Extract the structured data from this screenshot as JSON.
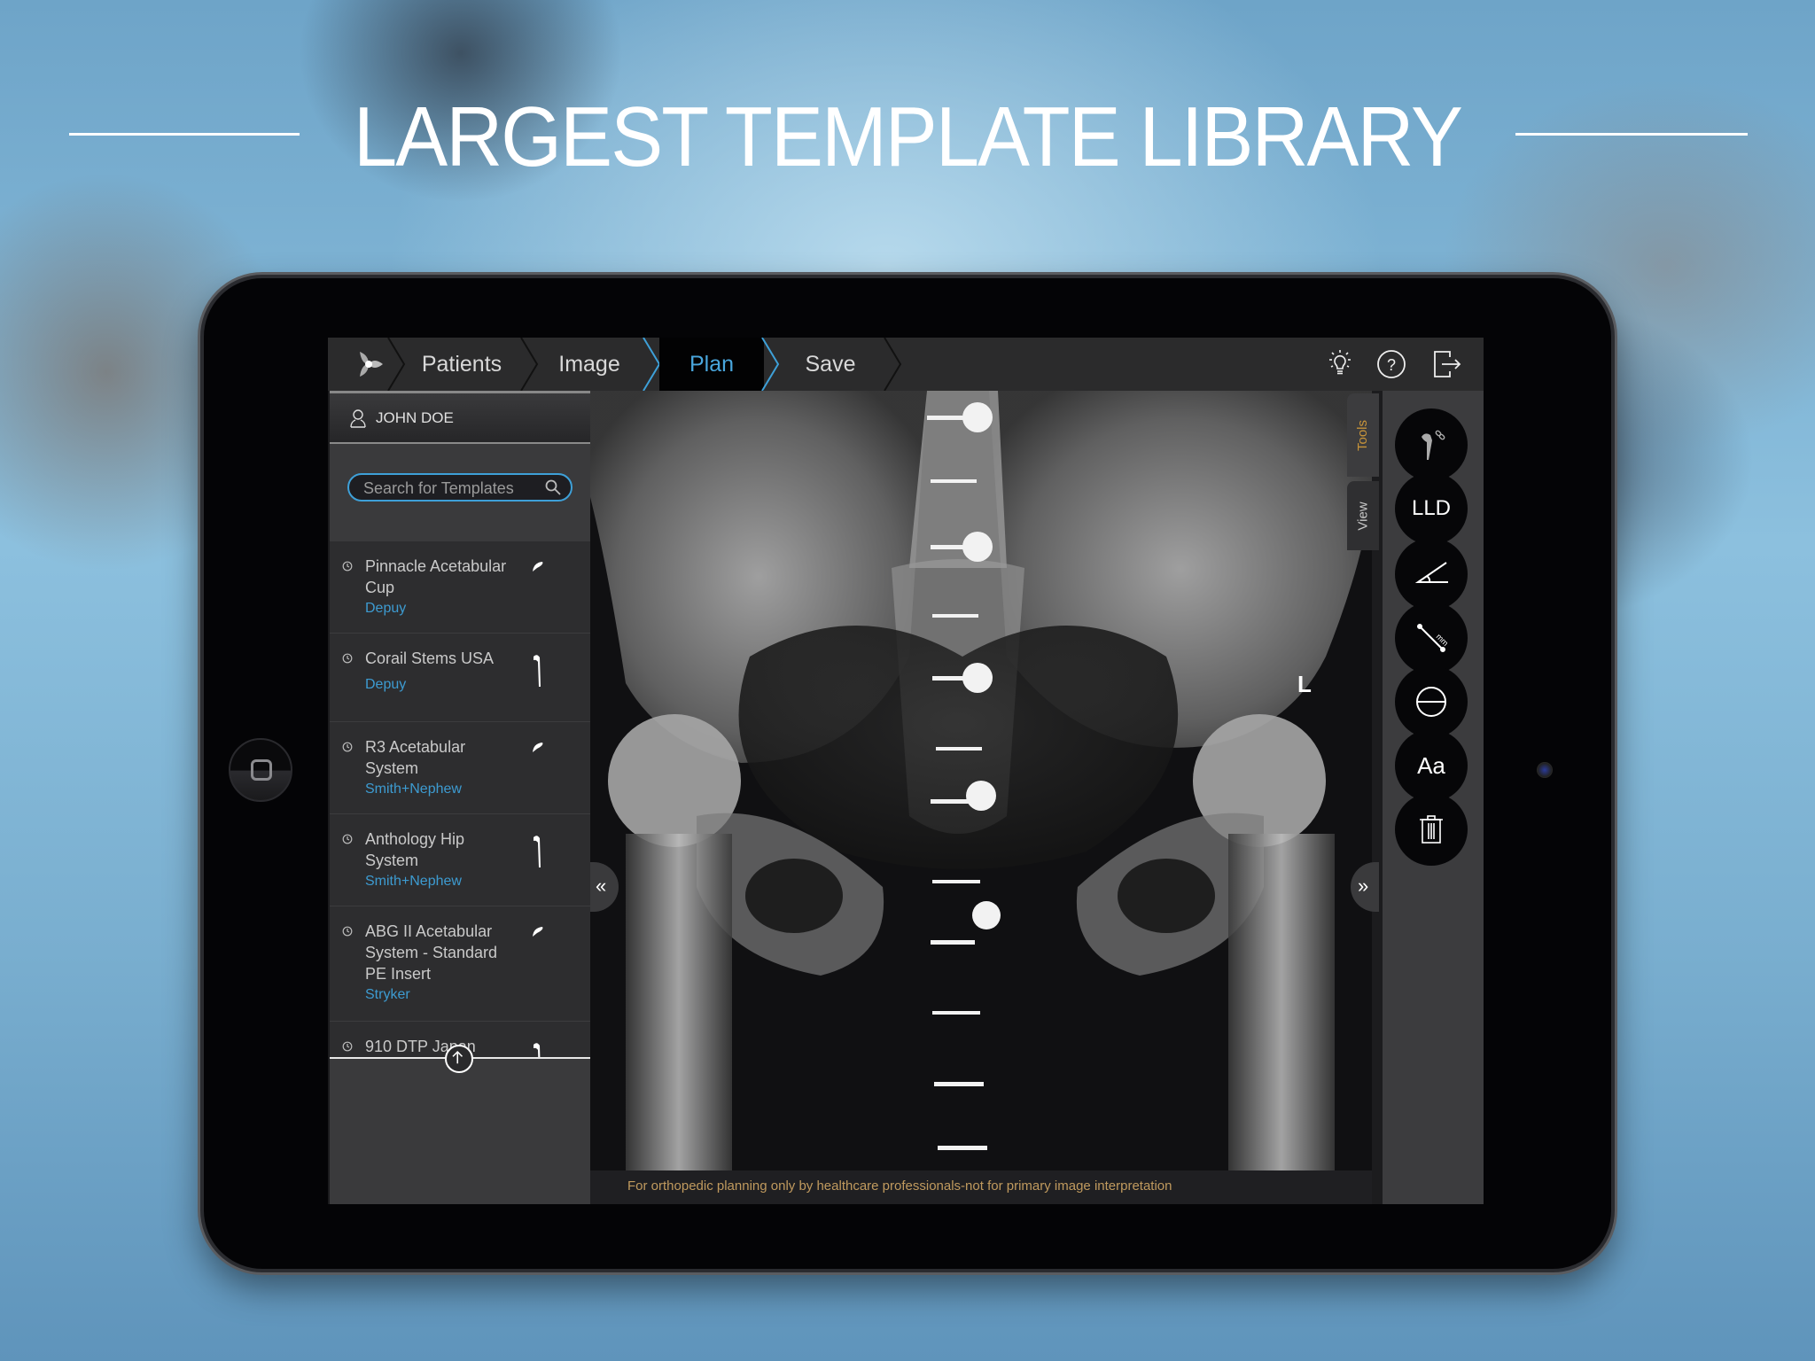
{
  "banner": {
    "headline": "LARGEST TEMPLATE LIBRARY"
  },
  "app": {
    "breadcrumbs": [
      {
        "label": "Patients",
        "active": false
      },
      {
        "label": "Image",
        "active": false
      },
      {
        "label": "Plan",
        "active": true
      },
      {
        "label": "Save",
        "active": false
      }
    ],
    "top_icons": [
      "lightbulb-icon",
      "help-icon",
      "logout-icon"
    ],
    "patient": {
      "name": "JOHN DOE"
    },
    "search": {
      "placeholder": "Search for Templates",
      "value": ""
    },
    "templates": [
      {
        "title": "Pinnacle Acetabular Cup",
        "brand": "Depuy",
        "kind": "cup"
      },
      {
        "title": "Corail Stems USA",
        "brand": "Depuy",
        "kind": "stem"
      },
      {
        "title": "R3 Acetabular System",
        "brand": "Smith+Nephew",
        "kind": "cup"
      },
      {
        "title": "Anthology Hip System",
        "brand": "Smith+Nephew",
        "kind": "stem"
      },
      {
        "title": "ABG II Acetabular System - Standard PE Insert",
        "brand": "Stryker",
        "kind": "cup"
      },
      {
        "title": "910 DTP Japan",
        "brand": "",
        "kind": "stem"
      }
    ],
    "image": {
      "laterality_marker": "L"
    },
    "disclaimer": "For orthopedic planning only by healthcare professionals-not for primary image interpretation",
    "side_tabs": {
      "tools": "Tools",
      "view": "View"
    },
    "tools": [
      {
        "name": "implant-template-tool",
        "label": ""
      },
      {
        "name": "leg-length-discrepancy-tool",
        "label": "LLD"
      },
      {
        "name": "angle-tool",
        "label": ""
      },
      {
        "name": "ruler-tool",
        "label": ""
      },
      {
        "name": "circle-tool",
        "label": ""
      },
      {
        "name": "text-tool",
        "label": "Aa"
      },
      {
        "name": "delete-tool",
        "label": ""
      }
    ],
    "colors": {
      "accent": "#3ea0d8",
      "brand_text": "#3d9bd1",
      "active_tab": "#c9953a",
      "disclaimer": "#c09a5e"
    }
  }
}
